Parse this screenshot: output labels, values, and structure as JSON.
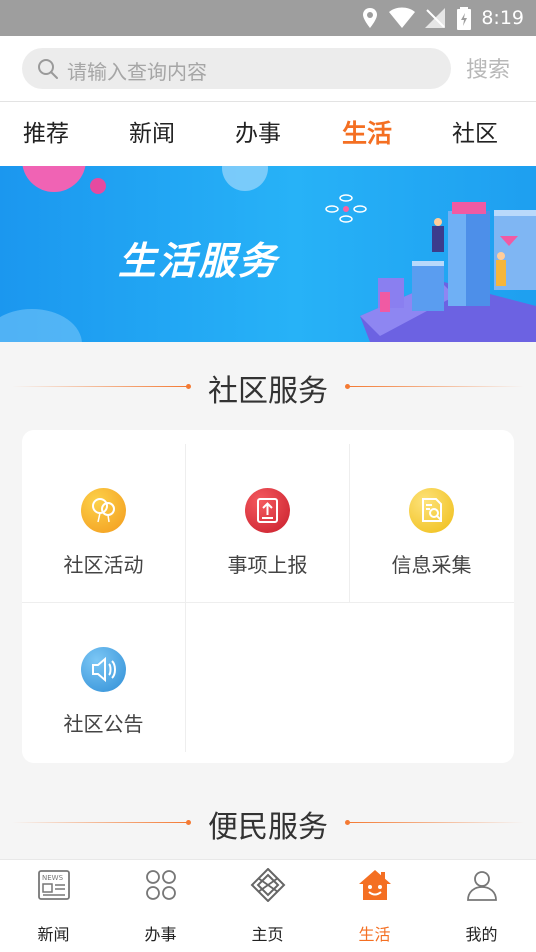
{
  "status_bar": {
    "time": "8:19"
  },
  "search": {
    "placeholder": "请输入查询内容",
    "button_label": "搜索"
  },
  "tabs": [
    {
      "label": "推荐",
      "active": false
    },
    {
      "label": "新闻",
      "active": false
    },
    {
      "label": "办事",
      "active": false
    },
    {
      "label": "生活",
      "active": true
    },
    {
      "label": "社区",
      "active": false
    }
  ],
  "banner": {
    "title": "生活服务"
  },
  "community_section": {
    "title": "社区服务",
    "items": [
      {
        "label": "社区活动",
        "icon": "balloon-icon",
        "color": "#f5a623"
      },
      {
        "label": "事项上报",
        "icon": "upload-report-icon",
        "color": "#e0303a"
      },
      {
        "label": "信息采集",
        "icon": "document-search-icon",
        "color": "#f2c31c"
      },
      {
        "label": "社区公告",
        "icon": "speaker-icon",
        "color": "#3aa3df"
      }
    ]
  },
  "convenience_section": {
    "title": "便民服务"
  },
  "bottom_nav": [
    {
      "label": "新闻",
      "icon": "news-icon",
      "active": false
    },
    {
      "label": "办事",
      "icon": "grid-icon",
      "active": false
    },
    {
      "label": "主页",
      "icon": "home-logo-icon",
      "active": false
    },
    {
      "label": "生活",
      "icon": "house-smile-icon",
      "active": true
    },
    {
      "label": "我的",
      "icon": "user-icon",
      "active": false
    }
  ],
  "colors": {
    "accent": "#f46f22",
    "banner_blue": "#1e9ff0"
  }
}
